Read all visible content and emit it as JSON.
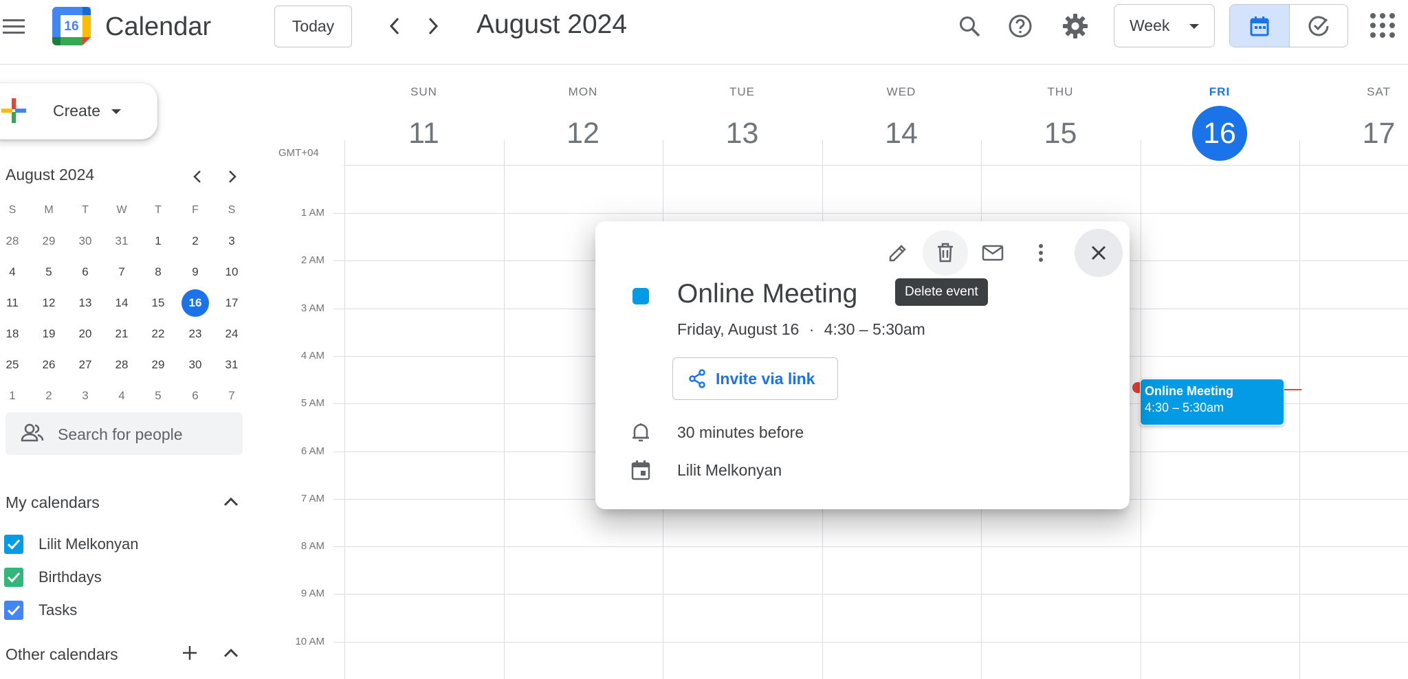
{
  "header": {
    "app_title": "Calendar",
    "logo_day": "16",
    "today_label": "Today",
    "title": "August 2024",
    "view_label": "Week",
    "icons": [
      "menu-icon",
      "chevron-left-icon",
      "chevron-right-icon",
      "search-icon",
      "help-icon",
      "settings-icon",
      "calendar-view-icon",
      "tasks-view-icon",
      "apps-grid-icon"
    ]
  },
  "sidebar": {
    "create_label": "Create",
    "mini_calendar": {
      "title": "August 2024",
      "weekdays": [
        "S",
        "M",
        "T",
        "W",
        "T",
        "F",
        "S"
      ],
      "weeks": [
        [
          "28",
          "29",
          "30",
          "31",
          "1",
          "2",
          "3"
        ],
        [
          "4",
          "5",
          "6",
          "7",
          "8",
          "9",
          "10"
        ],
        [
          "11",
          "12",
          "13",
          "14",
          "15",
          "16",
          "17"
        ],
        [
          "18",
          "19",
          "20",
          "21",
          "22",
          "23",
          "24"
        ],
        [
          "25",
          "26",
          "27",
          "28",
          "29",
          "30",
          "31"
        ],
        [
          "1",
          "2",
          "3",
          "4",
          "5",
          "6",
          "7"
        ]
      ],
      "selected_day": "16"
    },
    "search_people_placeholder": "Search for people",
    "my_calendars_title": "My calendars",
    "my_calendars": [
      {
        "label": "Lilit Melkonyan",
        "color": "#039be5",
        "checked": true
      },
      {
        "label": "Birthdays",
        "color": "#33b679",
        "checked": true
      },
      {
        "label": "Tasks",
        "color": "#4285f4",
        "checked": true
      }
    ],
    "other_calendars_title": "Other calendars"
  },
  "week": {
    "timezone": "GMT+04",
    "days": [
      {
        "dow": "SUN",
        "num": "11"
      },
      {
        "dow": "MON",
        "num": "12"
      },
      {
        "dow": "TUE",
        "num": "13"
      },
      {
        "dow": "WED",
        "num": "14"
      },
      {
        "dow": "THU",
        "num": "15"
      },
      {
        "dow": "FRI",
        "num": "16",
        "today": true
      },
      {
        "dow": "SAT",
        "num": "17"
      }
    ],
    "hours": [
      "1 AM",
      "2 AM",
      "3 AM",
      "4 AM",
      "5 AM",
      "6 AM",
      "7 AM",
      "8 AM",
      "9 AM",
      "10 AM"
    ],
    "event": {
      "title": "Online Meeting",
      "time": "4:30 – 5:30am",
      "color": "#039be5"
    }
  },
  "popup": {
    "tooltip": "Delete event",
    "title": "Online Meeting",
    "date": "Friday, August 16",
    "separator": "·",
    "time": "4:30 – 5:30am",
    "invite_label": "Invite via link",
    "reminder": "30 minutes before",
    "calendar_owner": "Lilit Melkonyan",
    "color": "#039be5"
  },
  "colors": {
    "accent": "#1a73e8",
    "event": "#039be5",
    "now_indicator": "#ea4335"
  }
}
